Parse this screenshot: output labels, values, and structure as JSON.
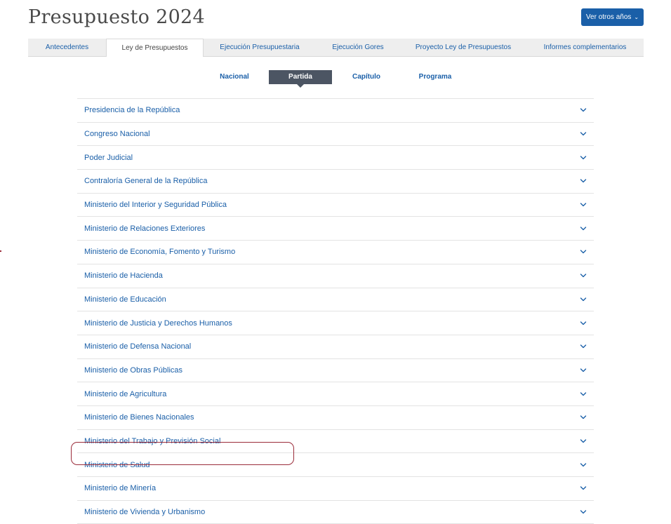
{
  "header": {
    "title": "Presupuesto 2024",
    "years_button_label": "Ver otros años",
    "years_button_color": "#1a5fa8"
  },
  "tabs": [
    {
      "label": "Antecedentes",
      "active": false
    },
    {
      "label": "Ley de Presupuestos",
      "active": true
    },
    {
      "label": "Ejecución Presupuestaria",
      "active": false
    },
    {
      "label": "Ejecución Gores",
      "active": false
    },
    {
      "label": "Proyecto Ley de Presupuestos",
      "active": false
    },
    {
      "label": "Informes complementarios",
      "active": false
    }
  ],
  "subnav": [
    {
      "label": "Nacional",
      "active": false
    },
    {
      "label": "Partida",
      "active": true
    },
    {
      "label": "Capítulo",
      "active": false
    },
    {
      "label": "Programa",
      "active": false
    }
  ],
  "partidas": [
    "Presidencia de la República",
    "Congreso Nacional",
    "Poder Judicial",
    "Contraloría General de la República",
    "Ministerio del Interior y Seguridad Pública",
    "Ministerio de Relaciones Exteriores",
    "Ministerio de Economía, Fomento y Turismo",
    "Ministerio de Hacienda",
    "Ministerio de Educación",
    "Ministerio de Justicia y Derechos Humanos",
    "Ministerio de Defensa Nacional",
    "Ministerio de Obras Públicas",
    "Ministerio de Agricultura",
    "Ministerio de Bienes Nacionales",
    "Ministerio del Trabajo y Previsión Social",
    "Ministerio de Salud",
    "Ministerio de Minería",
    "Ministerio de Vivienda y Urbanismo"
  ],
  "highlighted_partida": "Ministerio de Salud",
  "colors": {
    "link": "#1a5fa8",
    "active_pill": "#4c5563",
    "highlight_outline": "#9b2c3a"
  },
  "icons": {
    "row_expand": "chevron-down-icon",
    "years_dropdown": "chevron-down-icon"
  }
}
